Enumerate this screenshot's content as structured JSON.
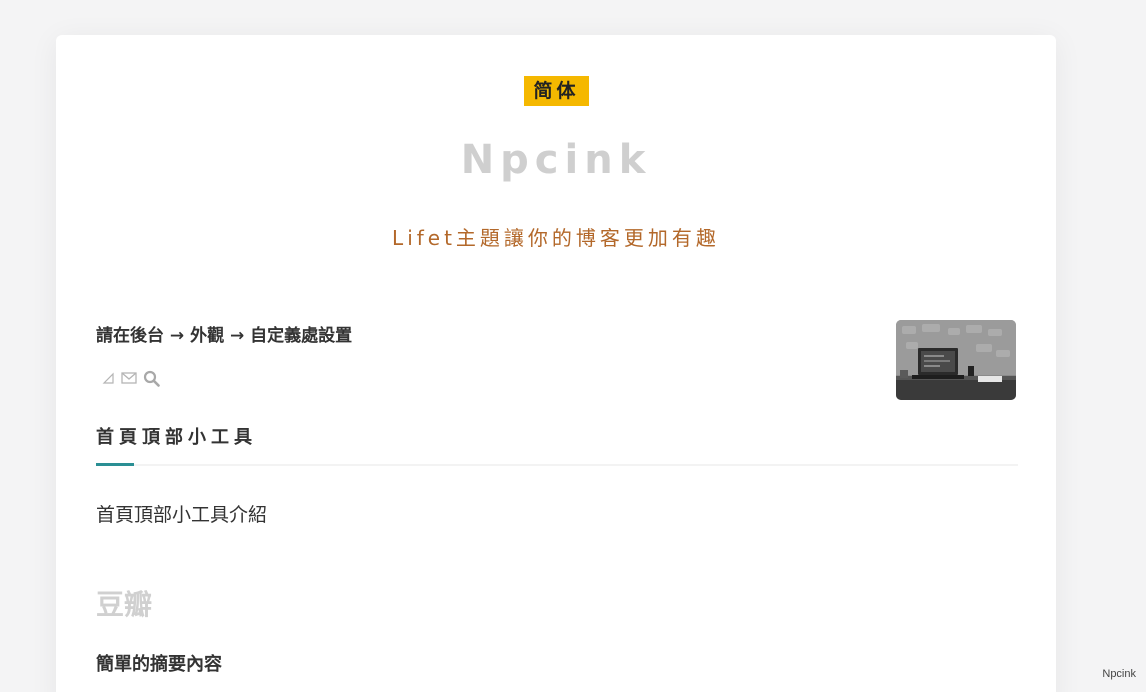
{
  "header": {
    "lang_toggle": "简体",
    "site_title": "Npcink",
    "site_description": "Lifet主題讓你的博客更加有趣"
  },
  "notice": {
    "text": "請在後台 → 外觀 → 自定義處設置"
  },
  "icons": [
    "rss-icon",
    "mail-icon",
    "search-icon"
  ],
  "widget": {
    "title": "首頁頂部小工具",
    "body": "首頁頂部小工具介紹"
  },
  "section": {
    "title": "豆瓣"
  },
  "post": {
    "title": "簡單的摘要內容"
  },
  "watermark": "Npcink",
  "colors": {
    "badge": "#f5b800",
    "accent": "#2a8f94",
    "description": "#b3682a"
  }
}
